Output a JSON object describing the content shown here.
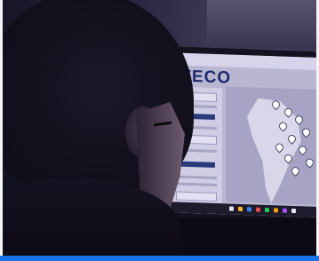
{
  "screen": {
    "brand": "IVECO"
  },
  "colors": {
    "accent_bar": "#1a73e8"
  }
}
